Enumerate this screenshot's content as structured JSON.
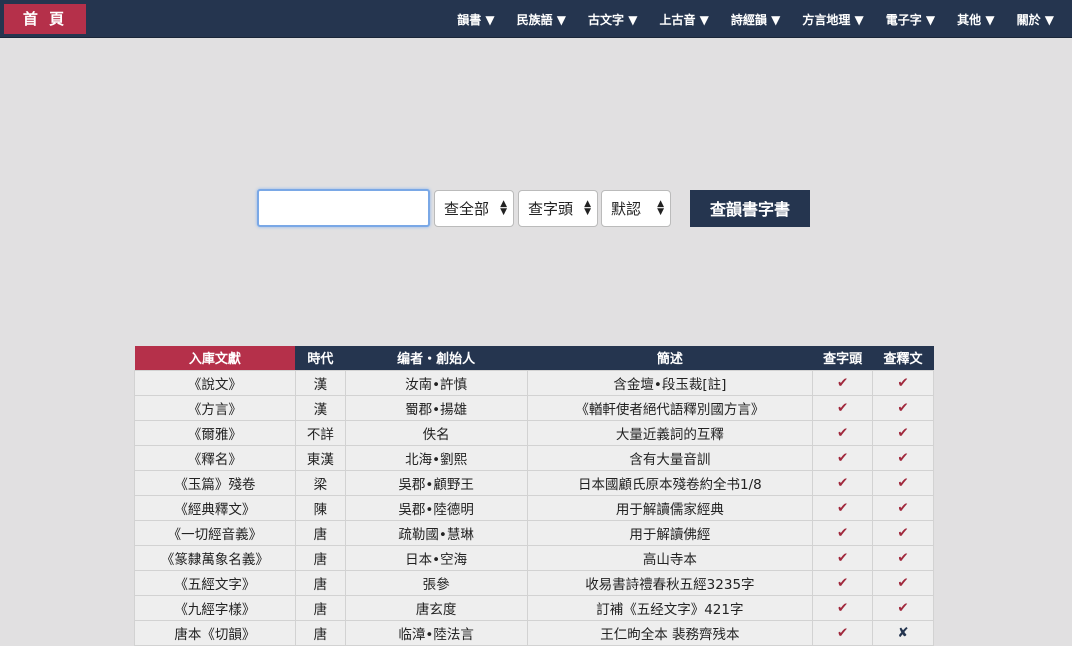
{
  "nav": {
    "home": "首 頁",
    "menu": [
      "韻書 ▼",
      "民族語 ▼",
      "古文字 ▼",
      "上古音 ▼",
      "詩經韻 ▼",
      "方言地理 ▼",
      "電子字 ▼",
      "其他 ▼",
      "關於 ▼"
    ]
  },
  "search": {
    "value": "",
    "scope": "查全部",
    "field": "查字頭",
    "mode": "默認",
    "button": "查韻書字書"
  },
  "table": {
    "headers": [
      "入庫文獻",
      "時代",
      "编者・創始人",
      "簡述",
      "查字頭",
      "查釋文"
    ],
    "rows": [
      [
        "《說文》",
        "漢",
        "汝南•許慎",
        "含金壇•段玉裁[註]",
        "✔",
        "✔"
      ],
      [
        "《方言》",
        "漢",
        "蜀郡•揚雄",
        "《輶軒使者絕代語釋別國方言》",
        "✔",
        "✔"
      ],
      [
        "《爾雅》",
        "不詳",
        "佚名",
        "大量近義詞的互釋",
        "✔",
        "✔"
      ],
      [
        "《釋名》",
        "東漢",
        "北海•劉熙",
        "含有大量音訓",
        "✔",
        "✔"
      ],
      [
        "《玉篇》殘卷",
        "梁",
        "吳郡•顧野王",
        "日本國顧氏原本殘卷約全书1/8",
        "✔",
        "✔"
      ],
      [
        "《經典釋文》",
        "陳",
        "吳郡•陸德明",
        "用于解讀儒家經典",
        "✔",
        "✔"
      ],
      [
        "《一切經音義》",
        "唐",
        "疏勒國•慧琳",
        "用于解讀佛經",
        "✔",
        "✔"
      ],
      [
        "《篆隸萬象名義》",
        "唐",
        "日本•空海",
        "高山寺本",
        "✔",
        "✔"
      ],
      [
        "《五經文字》",
        "唐",
        "張參",
        "收易書詩禮春秋五經3235字",
        "✔",
        "✔"
      ],
      [
        "《九經字樣》",
        "唐",
        "唐玄度",
        "訂補《五经文字》421字",
        "✔",
        "✔"
      ],
      [
        "唐本《切韻》",
        "唐",
        "临漳•陸法言",
        "王仁昫全本 裴務齊残本",
        "✔",
        "✘"
      ]
    ]
  }
}
